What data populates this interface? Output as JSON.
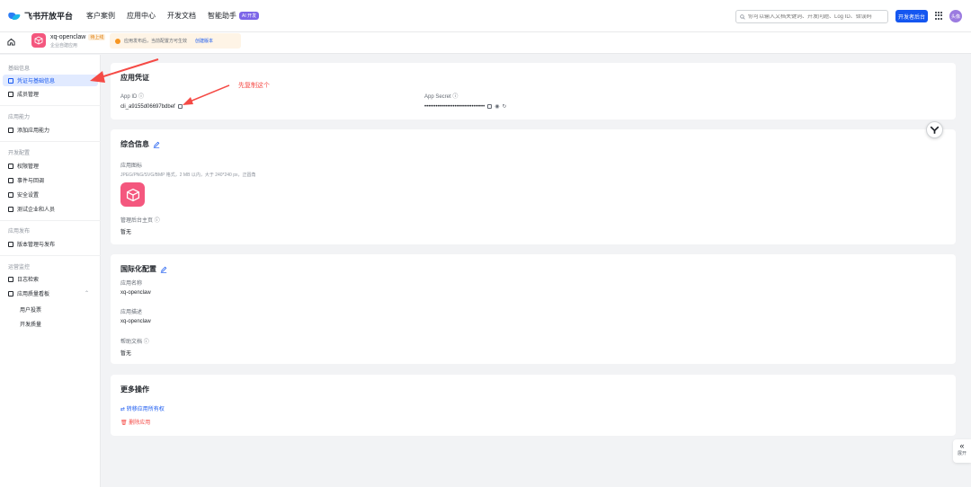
{
  "nav": {
    "logo_text": "飞书开放平台",
    "links": [
      "客户案例",
      "应用中心",
      "开发文档",
      "智能助手"
    ],
    "ai_badge": "AI 开发",
    "search_placeholder": "你可以输入文档关键词、开发问题、Log ID、错误码",
    "console_button": "开发者后台",
    "avatar_text": "头像"
  },
  "appbar": {
    "app_name": "xq-openclaw",
    "app_tag": "待上线",
    "app_subtitle": "企业自建应用",
    "notice_text": "应用发布后，当前配置方可生效",
    "notice_link": "创建版本"
  },
  "sidebar": {
    "groups": [
      "基础信息",
      "应用能力",
      "开发配置",
      "应用发布",
      "运营监控"
    ],
    "items": [
      {
        "label": "凭证与基础信息",
        "active": true
      },
      {
        "label": "成员管理"
      },
      {
        "label": "添加应用能力"
      },
      {
        "label": "权限管理"
      },
      {
        "label": "事件与回调"
      },
      {
        "label": "安全设置"
      },
      {
        "label": "测试企业和人员"
      },
      {
        "label": "版本管理与发布"
      },
      {
        "label": "日志检索"
      },
      {
        "label": "应用质量看板"
      }
    ],
    "subitems": [
      "用户投票",
      "开发质量"
    ]
  },
  "credentials": {
    "title": "应用凭证",
    "app_id_label": "App ID",
    "app_id_value": "cli_a9155d06697bdbef",
    "app_secret_label": "App Secret",
    "app_secret_value": "••••••••••••••••••••••••••••••••"
  },
  "general": {
    "title": "综合信息",
    "icon_label": "应用图标",
    "icon_hint": "JPEG/PNG/SVG/BMP 格式，2 MB 以内，大于 240*240 px，正圆角",
    "homepage_label": "管理后台主页",
    "homepage_value": "暂无"
  },
  "i18n": {
    "title": "国际化配置",
    "name_label": "应用名称",
    "name_value": "xq-openclaw",
    "desc_label": "应用描述",
    "desc_value": "xq-openclaw",
    "help_label": "帮助文档",
    "help_value": "暂无"
  },
  "more": {
    "title": "更多操作",
    "transfer": "转移应用所有权",
    "delete": "删除应用"
  },
  "annotation": {
    "text": "先复制这个",
    "color": "#f54a45"
  },
  "collapse": {
    "label": "展开"
  },
  "colors": {
    "primary": "#1456f0",
    "app_icon": "#f4577e",
    "active_bg": "#e1eaff"
  }
}
